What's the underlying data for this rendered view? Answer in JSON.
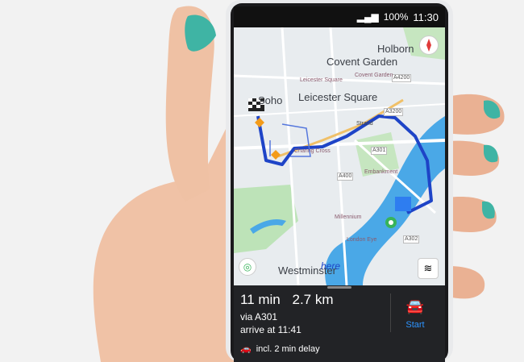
{
  "status": {
    "battery": "100%",
    "time": "11:30"
  },
  "map": {
    "labels": [
      "Covent Garden",
      "Leicester Square",
      "Holborn",
      "Westminster",
      "Soho"
    ],
    "roads": [
      "A4200",
      "A400",
      "A301",
      "A3200",
      "A302",
      "Strand"
    ],
    "small_labels": [
      "Covent Garden",
      "Leicester Square",
      "Charing Cross",
      "Embankment",
      "Millennium",
      "London Eye"
    ],
    "watermark": "here"
  },
  "route": {
    "duration": "11 min",
    "distance": "2.7 km",
    "via": "via A301",
    "arrive": "arrive at 11:41",
    "delay": "incl. 2 min delay",
    "start_label": "Start"
  },
  "colors": {
    "route": "#1e44c7",
    "water": "#4aa8e7",
    "panel": "#222326",
    "accent": "#2d94ff"
  }
}
